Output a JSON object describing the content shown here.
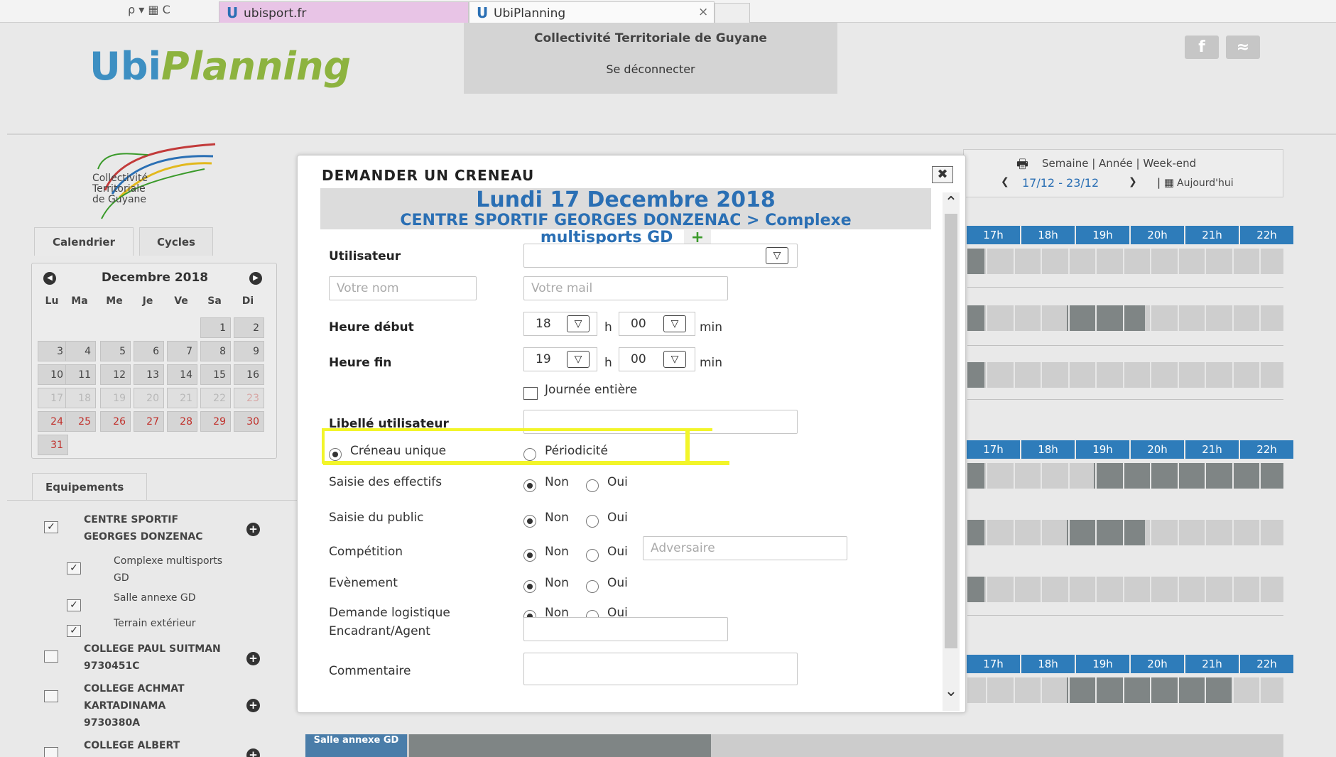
{
  "browser": {
    "address_icons": "ρ ▾ ▦ C",
    "tabs": [
      {
        "label": "ubisport.fr"
      },
      {
        "label": "UbiPlanning",
        "close": "×"
      }
    ]
  },
  "header": {
    "logo_part1": "Ubi",
    "logo_part2": "Planning",
    "org_name": "Collectivité Territoriale de Guyane",
    "logout": "Se déconnecter",
    "facebook_glyph": "f",
    "rss_glyph": "≈"
  },
  "sidebar": {
    "org_logo_lines": [
      "Collectivité",
      "Territoriale",
      "de Guyane"
    ],
    "tabs": [
      "Calendrier",
      "Cycles"
    ],
    "calendar": {
      "month": "Decembre 2018",
      "prev": "◀",
      "next": "▶",
      "weekdays": [
        "Lu",
        "Ma",
        "Me",
        "Je",
        "Ve",
        "Sa",
        "Di"
      ],
      "rows": [
        [
          "",
          "",
          "",
          "",
          "",
          "1",
          "2"
        ],
        [
          "3",
          "4",
          "5",
          "6",
          "7",
          "8",
          "9"
        ],
        [
          "10",
          "11",
          "12",
          "13",
          "14",
          "15",
          "16"
        ],
        [
          "17",
          "18",
          "19",
          "20",
          "21",
          "22",
          "23"
        ],
        [
          "24",
          "25",
          "26",
          "27",
          "28",
          "29",
          "30"
        ],
        [
          "31",
          "",
          "",
          "",
          "",
          "",
          ""
        ]
      ]
    },
    "equip_tab": "Equipements",
    "equipments": [
      {
        "lines": [
          "CENTRE SPORTIF",
          "GEORGES DONZENAC"
        ],
        "checked": true,
        "bold": true
      },
      {
        "lines": [
          "Complexe multisports",
          "GD"
        ],
        "checked": true,
        "bold": false
      },
      {
        "lines": [
          "Salle annexe GD"
        ],
        "checked": true,
        "bold": false
      },
      {
        "lines": [
          "Terrain extérieur"
        ],
        "checked": true,
        "bold": false
      },
      {
        "lines": [
          "COLLEGE PAUL SUITMAN",
          "9730451C"
        ],
        "checked": false,
        "bold": true
      },
      {
        "lines": [
          "COLLEGE ACHMAT",
          "KARTADINAMA",
          "9730380A"
        ],
        "checked": false,
        "bold": true
      },
      {
        "lines": [
          "COLLEGE ALBERT"
        ],
        "checked": false,
        "bold": true
      }
    ]
  },
  "planning": {
    "views": "Semaine | Année | Week-end",
    "range": "17/12 - 23/12",
    "today": "Aujourd'hui",
    "hours": [
      "17h",
      "18h",
      "19h",
      "20h",
      "21h",
      "22h"
    ],
    "bottom_label": "Salle annexe GD",
    "colors": {
      "hour_bg": "#2e7cba",
      "busy": "#7f8585",
      "free": "#cecece"
    }
  },
  "modal": {
    "title": "DEMANDER UN CRENEAU",
    "close": "✖",
    "date": "Lundi 17 Decembre 2018",
    "place_line1": "CENTRE SPORTIF GEORGES DONZENAC > Complexe",
    "place_line2": "multisports GD",
    "add": "+",
    "fields": {
      "utilisateur": "Utilisateur",
      "nom_placeholder": "Votre nom",
      "mail_placeholder": "Votre mail",
      "heure_debut": "Heure début",
      "heure_fin": "Heure fin",
      "debut_h": "18",
      "debut_min": "00",
      "fin_h": "19",
      "fin_min": "00",
      "h": "h",
      "min": "min",
      "journee": "Journée entière",
      "libelle": "Libellé utilisateur",
      "creneau_unique": "Créneau unique",
      "periodicite": "Périodicité",
      "saisie_effectifs": "Saisie des effectifs",
      "saisie_public": "Saisie du public",
      "competition": "Compétition",
      "adversaire_placeholder": "Adversaire",
      "evenement": "Evènement",
      "logistique": "Demande logistique",
      "encadrant": "Encadrant/Agent",
      "commentaire": "Commentaire",
      "non": "Non",
      "oui": "Oui"
    },
    "highlight_color": "#f2f52a"
  }
}
